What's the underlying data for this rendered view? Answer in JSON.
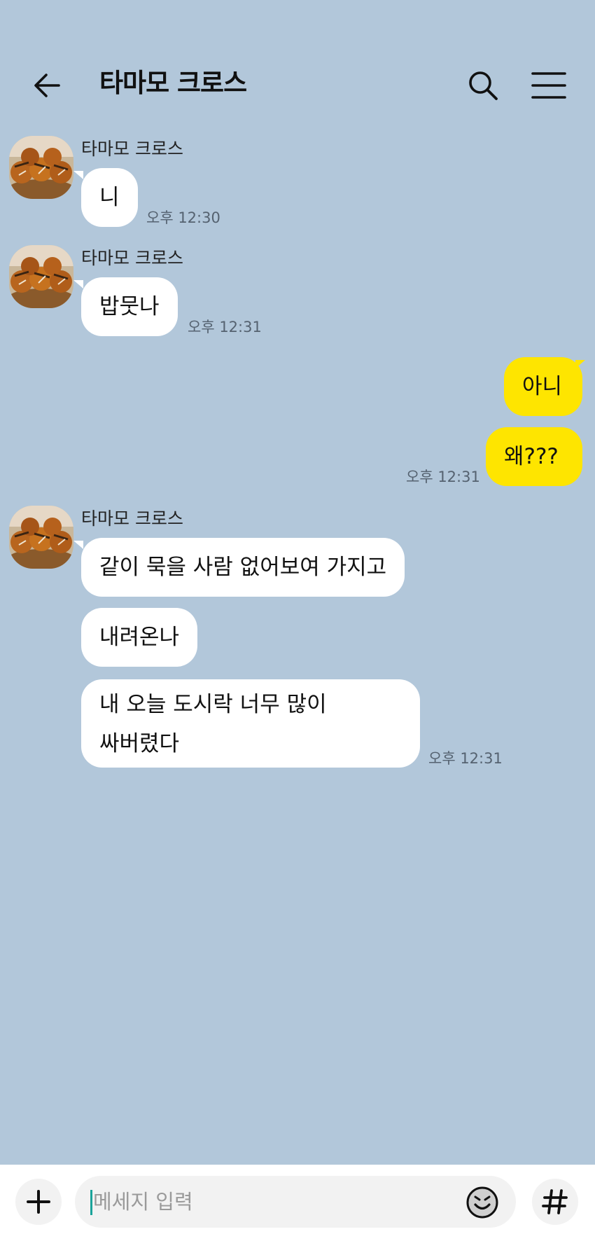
{
  "header": {
    "title": "타마모 크로스",
    "back_icon": "arrow-left-icon",
    "search_icon": "search-icon",
    "menu_icon": "hamburger-menu-icon"
  },
  "messages": [
    {
      "sender": "타마모 크로스",
      "texts": [
        "니"
      ],
      "time": "오후 12:30"
    },
    {
      "sender": "타마모 크로스",
      "texts": [
        "밥뭇나"
      ],
      "time": "오후 12:31"
    },
    {
      "sender": "me",
      "texts": [
        "아니",
        "왜???"
      ],
      "time": "오후 12:31"
    },
    {
      "sender": "타마모 크로스",
      "texts": [
        "같이 묵을 사람 없어보여 가지고",
        "내려온나",
        "내 오늘 도시락 너무 많이\n싸버렸다"
      ],
      "time": "오후 12:31"
    }
  ],
  "input": {
    "placeholder": "메세지 입력",
    "plus_icon": "plus-icon",
    "emoji_icon": "emoji-icon",
    "hash_icon": "hashtag-icon"
  },
  "colors": {
    "background": "#b2c7da",
    "my_bubble": "#fee500",
    "other_bubble": "#ffffff"
  }
}
